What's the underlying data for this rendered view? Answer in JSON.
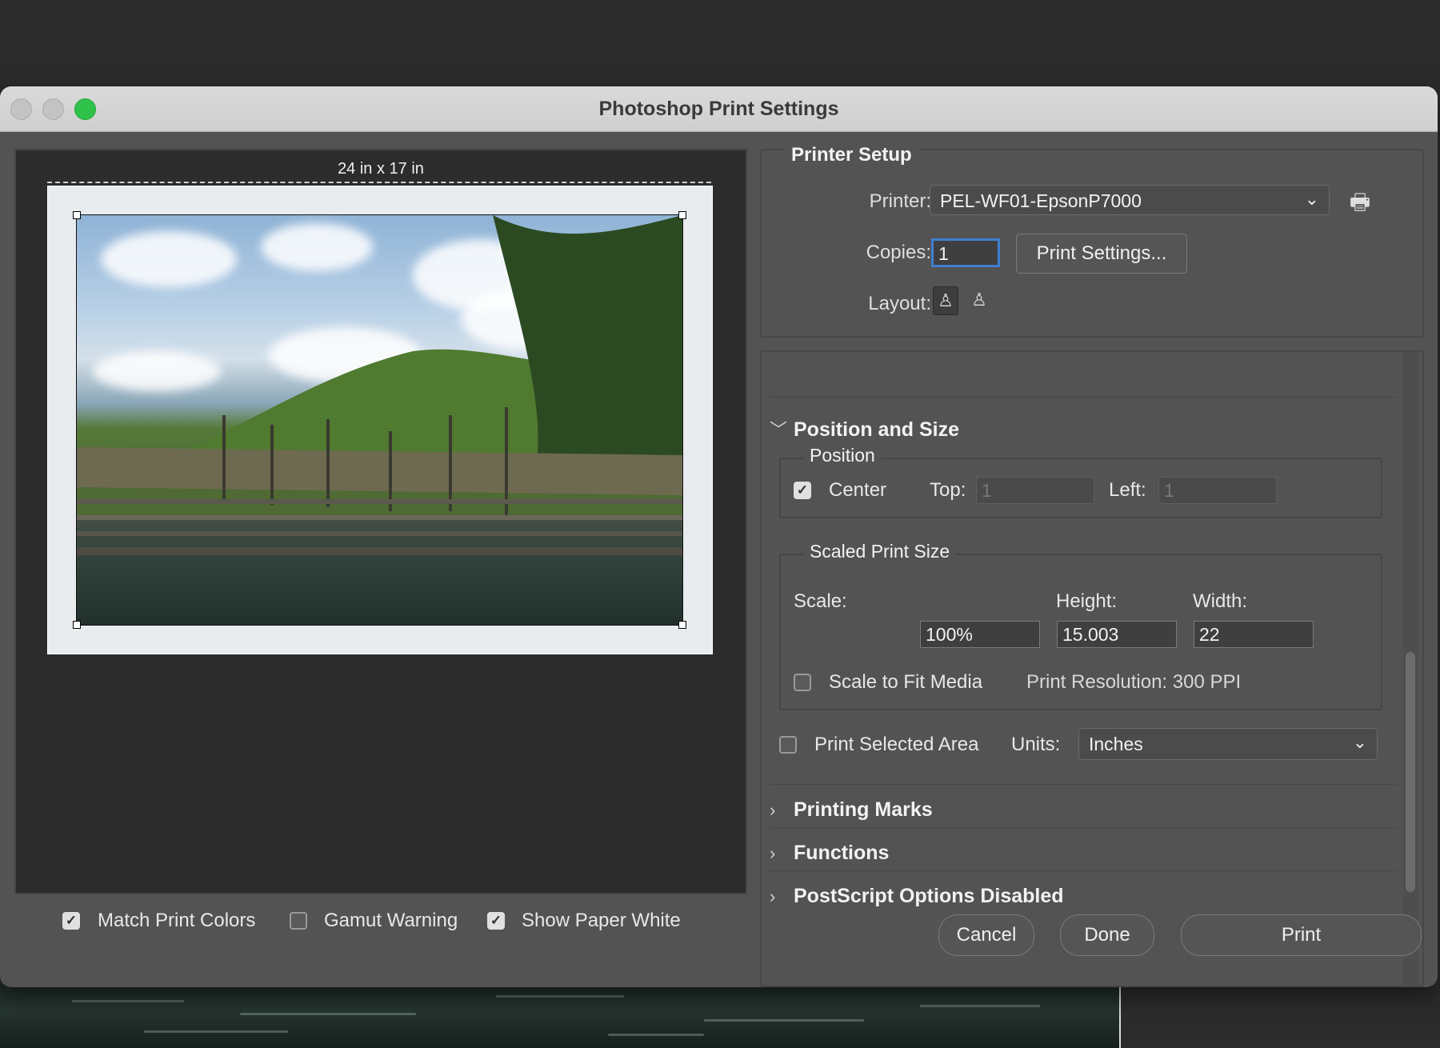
{
  "window": {
    "title": "Photoshop Print Settings"
  },
  "preview": {
    "paper_size": "24 in x 17 in",
    "match_print_colors": {
      "label": "Match Print Colors",
      "checked": true
    },
    "gamut_warning": {
      "label": "Gamut Warning",
      "checked": false
    },
    "show_paper_white": {
      "label": "Show Paper White",
      "checked": true
    }
  },
  "printer_setup": {
    "title": "Printer Setup",
    "printer_label": "Printer:",
    "printer_value": "PEL-WF01-EpsonP7000",
    "copies_label": "Copies:",
    "copies_value": "1",
    "print_settings_button": "Print Settings...",
    "layout_label": "Layout:"
  },
  "position_and_size": {
    "title": "Position and Size",
    "position": {
      "title": "Position",
      "center_label": "Center",
      "center_checked": true,
      "top_label": "Top:",
      "top_value": "1",
      "left_label": "Left:",
      "left_value": "1"
    },
    "scaled_print_size": {
      "title": "Scaled Print Size",
      "scale_label": "Scale:",
      "scale_value": "100%",
      "height_label": "Height:",
      "height_value": "15.003",
      "width_label": "Width:",
      "width_value": "22",
      "scale_to_fit_label": "Scale to Fit Media",
      "scale_to_fit_checked": false,
      "print_resolution": "Print Resolution: 300 PPI"
    },
    "print_selected_area_label": "Print Selected Area",
    "print_selected_area_checked": false,
    "units_label": "Units:",
    "units_value": "Inches"
  },
  "sections": {
    "printing_marks": "Printing Marks",
    "functions": "Functions",
    "postscript": "PostScript Options Disabled"
  },
  "buttons": {
    "cancel": "Cancel",
    "done": "Done",
    "print": "Print"
  },
  "icons": {
    "checkmark": "✓",
    "chevron_down": "⌄",
    "disclosure_open": "﹀",
    "disclosure_closed": "›",
    "add_printer": "🖶"
  }
}
